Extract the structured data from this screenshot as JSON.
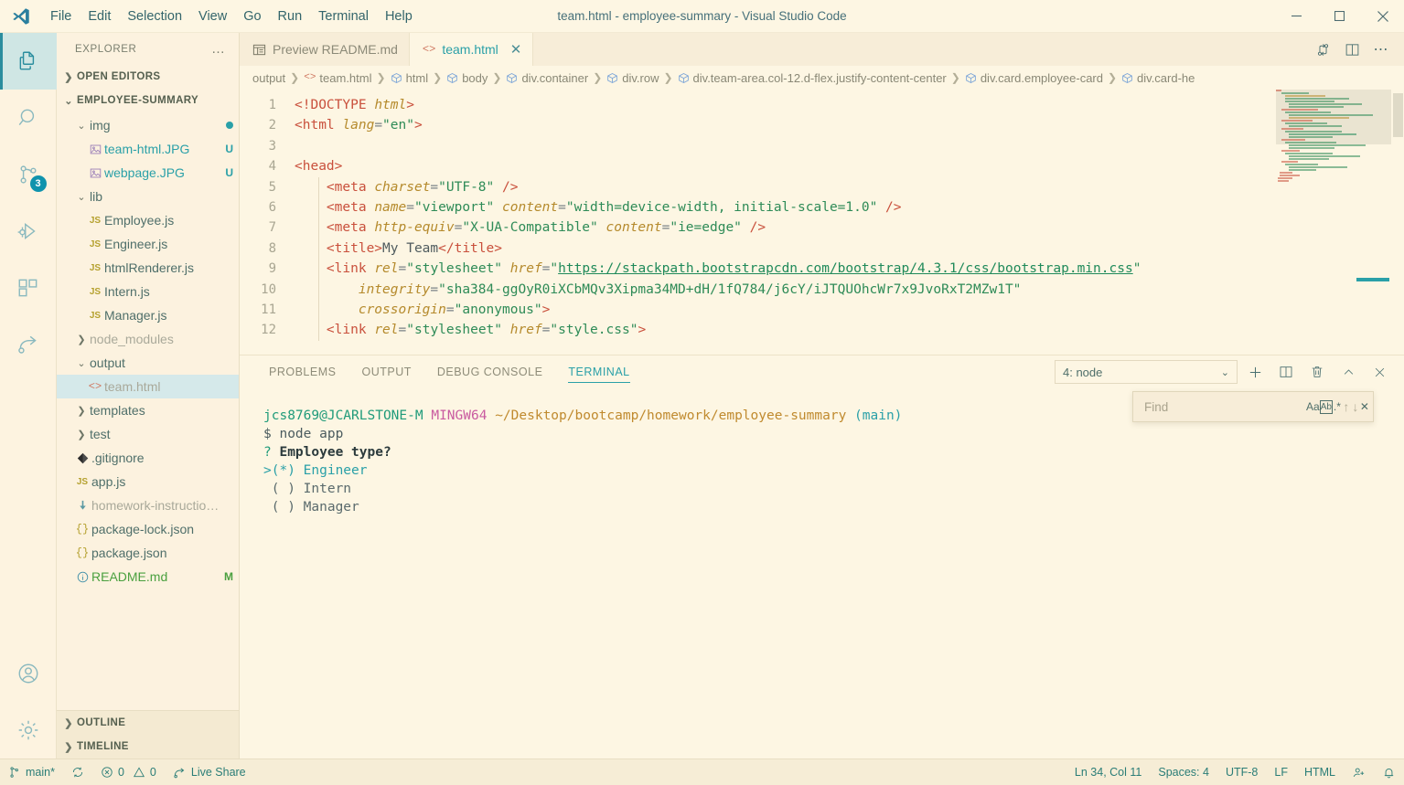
{
  "titlebar": {
    "title": "team.html - employee-summary - Visual Studio Code",
    "menus": [
      "File",
      "Edit",
      "Selection",
      "View",
      "Go",
      "Run",
      "Terminal",
      "Help"
    ],
    "minimize_label": "minimize-icon",
    "maximize_label": "maximize-icon",
    "close_label": "close-icon"
  },
  "activitybar": {
    "items": [
      {
        "name": "explorer",
        "icon": "files-icon",
        "badge": ""
      },
      {
        "name": "search",
        "icon": "search-icon",
        "badge": ""
      },
      {
        "name": "source-control",
        "icon": "source-control-icon",
        "badge": "3"
      },
      {
        "name": "run-and-debug",
        "icon": "run-debug-icon",
        "badge": ""
      },
      {
        "name": "extensions",
        "icon": "extensions-icon",
        "badge": ""
      },
      {
        "name": "live-share",
        "icon": "live-share-icon",
        "badge": ""
      }
    ],
    "bottom": [
      {
        "name": "accounts",
        "icon": "account-icon"
      },
      {
        "name": "manage",
        "icon": "gear-icon"
      }
    ]
  },
  "sidebar": {
    "header": "EXPLORER",
    "header_more": "…",
    "open_editors": "OPEN EDITORS",
    "project": "EMPLOYEE-SUMMARY",
    "tree": [
      {
        "label": "img",
        "indent": 18,
        "icon": "chevron-down",
        "kind": "folder",
        "badge": "dot"
      },
      {
        "label": "team-html.JPG",
        "indent": 32,
        "icon": "image",
        "kind": "file-teal",
        "badge": "U"
      },
      {
        "label": "webpage.JPG",
        "indent": 32,
        "icon": "image",
        "kind": "file-teal",
        "badge": "U"
      },
      {
        "label": "lib",
        "indent": 18,
        "icon": "chevron-down",
        "kind": "folder",
        "badge": ""
      },
      {
        "label": "Employee.js",
        "indent": 32,
        "icon": "js",
        "kind": "file",
        "badge": ""
      },
      {
        "label": "Engineer.js",
        "indent": 32,
        "icon": "js",
        "kind": "file",
        "badge": ""
      },
      {
        "label": "htmlRenderer.js",
        "indent": 32,
        "icon": "js",
        "kind": "file",
        "badge": ""
      },
      {
        "label": "Intern.js",
        "indent": 32,
        "icon": "js",
        "kind": "file",
        "badge": ""
      },
      {
        "label": "Manager.js",
        "indent": 32,
        "icon": "js",
        "kind": "file",
        "badge": ""
      },
      {
        "label": "node_modules",
        "indent": 18,
        "icon": "chevron-right",
        "kind": "dim",
        "badge": ""
      },
      {
        "label": "output",
        "indent": 18,
        "icon": "chevron-down",
        "kind": "folder",
        "badge": ""
      },
      {
        "label": "team.html",
        "indent": 32,
        "icon": "code",
        "kind": "selected",
        "badge": ""
      },
      {
        "label": "templates",
        "indent": 18,
        "icon": "chevron-right",
        "kind": "folder",
        "badge": ""
      },
      {
        "label": "test",
        "indent": 18,
        "icon": "chevron-right",
        "kind": "folder",
        "badge": ""
      },
      {
        "label": ".gitignore",
        "indent": 18,
        "icon": "git",
        "kind": "file",
        "badge": ""
      },
      {
        "label": "app.js",
        "indent": 18,
        "icon": "js",
        "kind": "file",
        "badge": ""
      },
      {
        "label": "homework-instructio…",
        "indent": 18,
        "icon": "pdf",
        "kind": "dim",
        "badge": ""
      },
      {
        "label": "package-lock.json",
        "indent": 18,
        "icon": "json",
        "kind": "file",
        "badge": ""
      },
      {
        "label": "package.json",
        "indent": 18,
        "icon": "json",
        "kind": "file",
        "badge": ""
      },
      {
        "label": "README.md",
        "indent": 18,
        "icon": "info",
        "kind": "file-green",
        "badge": "M"
      }
    ],
    "outline": "OUTLINE",
    "timeline": "TIMELINE"
  },
  "tabs": [
    {
      "label": "Preview README.md",
      "icon": "preview-icon",
      "active": false,
      "closable": false
    },
    {
      "label": "team.html",
      "icon": "code-icon",
      "active": true,
      "closable": true
    }
  ],
  "tab_actions": [
    {
      "name": "split-diff-icon",
      "label": "⑂"
    },
    {
      "name": "split-editor-icon",
      "label": "▯"
    },
    {
      "name": "more-actions-icon",
      "label": "…"
    }
  ],
  "breadcrumb": [
    "output",
    "team.html",
    "html",
    "body",
    "div.container",
    "div.row",
    "div.team-area.col-12.d-flex.justify-content-center",
    "div.card.employee-card",
    "div.card-he"
  ],
  "editor": {
    "lines": [
      {
        "n": "1",
        "indent": false,
        "tokens": [
          {
            "t": "<!DOCTYPE ",
            "c": "tag"
          },
          {
            "t": "html",
            "c": "attr"
          },
          {
            "t": ">",
            "c": "tag"
          }
        ]
      },
      {
        "n": "2",
        "indent": false,
        "tokens": [
          {
            "t": "<html ",
            "c": "tag"
          },
          {
            "t": "lang",
            "c": "attr"
          },
          {
            "t": "=",
            "c": "pun"
          },
          {
            "t": "\"en\"",
            "c": "str"
          },
          {
            "t": ">",
            "c": "tag"
          }
        ]
      },
      {
        "n": "3",
        "indent": false,
        "tokens": []
      },
      {
        "n": "4",
        "indent": false,
        "tokens": [
          {
            "t": "<head>",
            "c": "tag"
          }
        ]
      },
      {
        "n": "5",
        "indent": true,
        "tokens": [
          {
            "t": "    <meta ",
            "c": "tag"
          },
          {
            "t": "charset",
            "c": "attr"
          },
          {
            "t": "=",
            "c": "pun"
          },
          {
            "t": "\"UTF-8\"",
            "c": "str"
          },
          {
            "t": " />",
            "c": "tag"
          }
        ]
      },
      {
        "n": "6",
        "indent": true,
        "tokens": [
          {
            "t": "    <meta ",
            "c": "tag"
          },
          {
            "t": "name",
            "c": "attr"
          },
          {
            "t": "=",
            "c": "pun"
          },
          {
            "t": "\"viewport\"",
            "c": "str"
          },
          {
            "t": " ",
            "c": "pun"
          },
          {
            "t": "content",
            "c": "attr"
          },
          {
            "t": "=",
            "c": "pun"
          },
          {
            "t": "\"width=device-width, initial-scale=1.0\"",
            "c": "str"
          },
          {
            "t": " />",
            "c": "tag"
          }
        ]
      },
      {
        "n": "7",
        "indent": true,
        "tokens": [
          {
            "t": "    <meta ",
            "c": "tag"
          },
          {
            "t": "http-equiv",
            "c": "attr"
          },
          {
            "t": "=",
            "c": "pun"
          },
          {
            "t": "\"X-UA-Compatible\"",
            "c": "str"
          },
          {
            "t": " ",
            "c": "pun"
          },
          {
            "t": "content",
            "c": "attr"
          },
          {
            "t": "=",
            "c": "pun"
          },
          {
            "t": "\"ie=edge\"",
            "c": "str"
          },
          {
            "t": " />",
            "c": "tag"
          }
        ]
      },
      {
        "n": "8",
        "indent": true,
        "tokens": [
          {
            "t": "    <title>",
            "c": "tag"
          },
          {
            "t": "My Team",
            "c": "txt"
          },
          {
            "t": "</title>",
            "c": "tag"
          }
        ]
      },
      {
        "n": "9",
        "indent": true,
        "tokens": [
          {
            "t": "    <link ",
            "c": "tag"
          },
          {
            "t": "rel",
            "c": "attr"
          },
          {
            "t": "=",
            "c": "pun"
          },
          {
            "t": "\"stylesheet\"",
            "c": "str"
          },
          {
            "t": " ",
            "c": "pun"
          },
          {
            "t": "href",
            "c": "attr"
          },
          {
            "t": "=",
            "c": "pun"
          },
          {
            "t": "\"",
            "c": "str"
          },
          {
            "t": "https://stackpath.bootstrapcdn.com/bootstrap/4.3.1/css/bootstrap.min.css",
            "c": "link"
          },
          {
            "t": "\"",
            "c": "str"
          }
        ]
      },
      {
        "n": "10",
        "indent": true,
        "tokens": [
          {
            "t": "        integrity",
            "c": "attr"
          },
          {
            "t": "=",
            "c": "pun"
          },
          {
            "t": "\"sha384-ggOyR0iXCbMQv3Xipma34MD+dH/1fQ784/j6cY/iJTQUOhcWr7x9JvoRxT2MZw1T\"",
            "c": "str"
          }
        ]
      },
      {
        "n": "11",
        "indent": true,
        "tokens": [
          {
            "t": "        crossorigin",
            "c": "attr"
          },
          {
            "t": "=",
            "c": "pun"
          },
          {
            "t": "\"anonymous\"",
            "c": "str"
          },
          {
            "t": ">",
            "c": "tag"
          }
        ]
      },
      {
        "n": "12",
        "indent": true,
        "tokens": [
          {
            "t": "    <link ",
            "c": "tag"
          },
          {
            "t": "rel",
            "c": "attr"
          },
          {
            "t": "=",
            "c": "pun"
          },
          {
            "t": "\"stylesheet\"",
            "c": "str"
          },
          {
            "t": " ",
            "c": "pun"
          },
          {
            "t": "href",
            "c": "attr"
          },
          {
            "t": "=",
            "c": "pun"
          },
          {
            "t": "\"style.css\"",
            "c": "str"
          },
          {
            "t": ">",
            "c": "tag"
          }
        ]
      }
    ],
    "visible_line_numbers": [
      "1",
      "2",
      "3",
      "4",
      "5",
      "6",
      "7",
      "8",
      "9",
      "10",
      "11"
    ]
  },
  "panel": {
    "tabs": [
      "PROBLEMS",
      "OUTPUT",
      "DEBUG CONSOLE",
      "TERMINAL"
    ],
    "active_tab": "TERMINAL",
    "terminal_select": "4: node",
    "actions": [
      {
        "name": "new-terminal-icon",
        "label": "+"
      },
      {
        "name": "split-terminal-icon",
        "label": "▯"
      },
      {
        "name": "kill-terminal-icon",
        "label": "🗑"
      },
      {
        "name": "maximize-panel-icon",
        "label": "^"
      },
      {
        "name": "close-panel-icon",
        "label": "✕"
      }
    ],
    "find": {
      "placeholder": "Find",
      "value": "",
      "match_case": "Aa",
      "whole_word": "Ab",
      "regex": ".*",
      "prev": "↑",
      "next": "↓",
      "close": "✕"
    },
    "terminal_lines": [
      {
        "segments": [
          {
            "t": "jcs8769@JCARLSTONE-M",
            "c": "user"
          },
          {
            "t": " ",
            "c": "def"
          },
          {
            "t": "MINGW64",
            "c": "host"
          },
          {
            "t": " ",
            "c": "def"
          },
          {
            "t": "~/Desktop/bootcamp/homework/employee-summary",
            "c": "path"
          },
          {
            "t": " ",
            "c": "def"
          },
          {
            "t": "(main)",
            "c": "branch"
          }
        ]
      },
      {
        "segments": [
          {
            "t": "$ node app",
            "c": "def"
          }
        ]
      },
      {
        "segments": [
          {
            "t": "? ",
            "c": "q"
          },
          {
            "t": "Employee type?",
            "c": "bold"
          }
        ]
      },
      {
        "segments": [
          {
            "t": ">(*) ",
            "c": "sel"
          },
          {
            "t": "Engineer",
            "c": "sel"
          }
        ]
      },
      {
        "segments": [
          {
            "t": " ( ) Intern",
            "c": "dim"
          }
        ]
      },
      {
        "segments": [
          {
            "t": " ( ) Manager",
            "c": "dim"
          }
        ]
      }
    ]
  },
  "statusbar": {
    "left": [
      {
        "name": "remote-branch",
        "icon": "source-control-icon",
        "label": "main*"
      },
      {
        "name": "sync-changes",
        "icon": "sync-icon",
        "label": ""
      },
      {
        "name": "problems",
        "icon": "error-warning-icon",
        "label": "0  0"
      },
      {
        "name": "live-share",
        "icon": "live-share-icon",
        "label": "Live Share"
      }
    ],
    "right": [
      {
        "name": "cursor-position",
        "label": "Ln 34, Col 11"
      },
      {
        "name": "indentation",
        "label": "Spaces: 4"
      },
      {
        "name": "encoding",
        "label": "UTF-8"
      },
      {
        "name": "eol",
        "label": "LF"
      },
      {
        "name": "language-mode",
        "label": "HTML"
      },
      {
        "name": "feedback",
        "label": ""
      },
      {
        "name": "notifications",
        "label": ""
      }
    ],
    "errors": "0",
    "warnings": "0"
  },
  "colors": {
    "background": "#fdf6e3",
    "accent": "#2aa0a8",
    "tag": "#c9503c",
    "attr": "#b58a2c",
    "string": "#2e8b57",
    "badge": "#0f93ad"
  }
}
